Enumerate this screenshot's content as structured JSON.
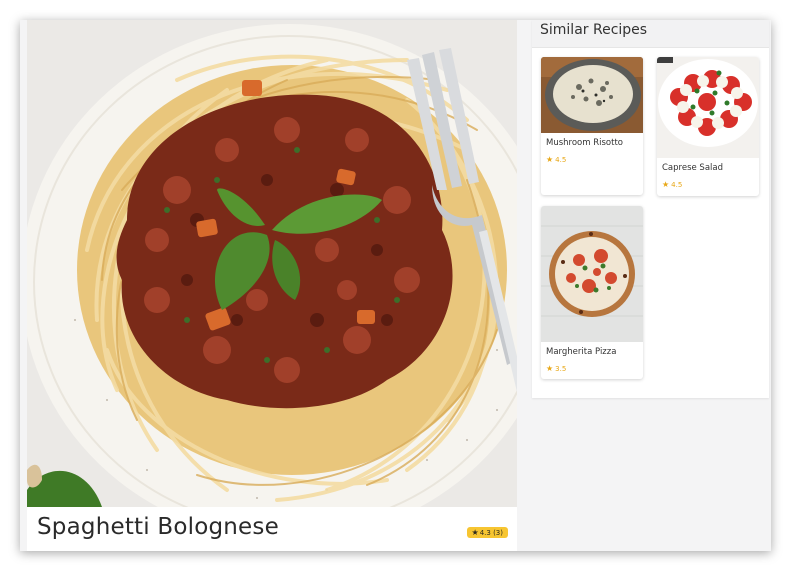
{
  "hero": {
    "title": "Spaghetti Bolognese",
    "rating_text": "4.3 (3)",
    "rating_icon": "star-icon"
  },
  "similar": {
    "heading": "Similar Recipes",
    "items": [
      {
        "name": "Mushroom Risotto",
        "rating": "4.5"
      },
      {
        "name": "Caprese Salad",
        "rating": "4.5"
      },
      {
        "name": "Margherita Pizza",
        "rating": "3.5"
      }
    ]
  },
  "colors": {
    "rating_badge": "#f7c531",
    "star": "#e8a716",
    "panel_header": "#f2f2f3"
  }
}
